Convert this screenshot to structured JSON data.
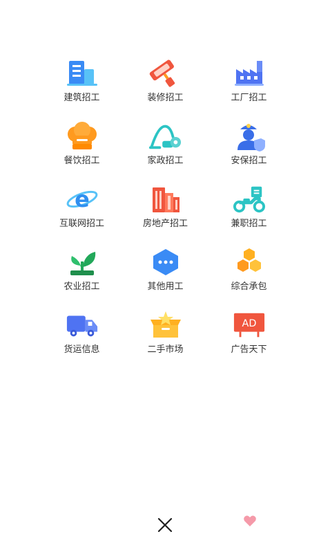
{
  "categories": [
    {
      "label": "建筑招工",
      "icon": "building-icon"
    },
    {
      "label": "装修招工",
      "icon": "paint-roller-icon"
    },
    {
      "label": "工厂招工",
      "icon": "factory-icon"
    },
    {
      "label": "餐饮招工",
      "icon": "chef-hat-icon"
    },
    {
      "label": "家政招工",
      "icon": "vacuum-icon"
    },
    {
      "label": "安保招工",
      "icon": "security-guard-icon"
    },
    {
      "label": "互联网招工",
      "icon": "browser-e-icon"
    },
    {
      "label": "房地产招工",
      "icon": "buildings-icon"
    },
    {
      "label": "兼职招工",
      "icon": "scooter-icon"
    },
    {
      "label": "农业招工",
      "icon": "sprout-icon"
    },
    {
      "label": "其他用工",
      "icon": "more-dots-icon"
    },
    {
      "label": "综合承包",
      "icon": "honeycomb-icon"
    },
    {
      "label": "货运信息",
      "icon": "truck-icon"
    },
    {
      "label": "二手市场",
      "icon": "star-box-icon"
    },
    {
      "label": "广告天下",
      "icon": "ad-board-icon"
    }
  ],
  "ad_badge_text": "AD",
  "close_icon": "close-icon",
  "heart_icon": "heart-icon",
  "colors": {
    "blue": "#3a8bf5",
    "light_blue": "#58c2f7",
    "orange": "#ff9a1f",
    "red": "#f0563e",
    "teal": "#2cc4c4",
    "green": "#2fbf6d",
    "text": "#333333"
  }
}
